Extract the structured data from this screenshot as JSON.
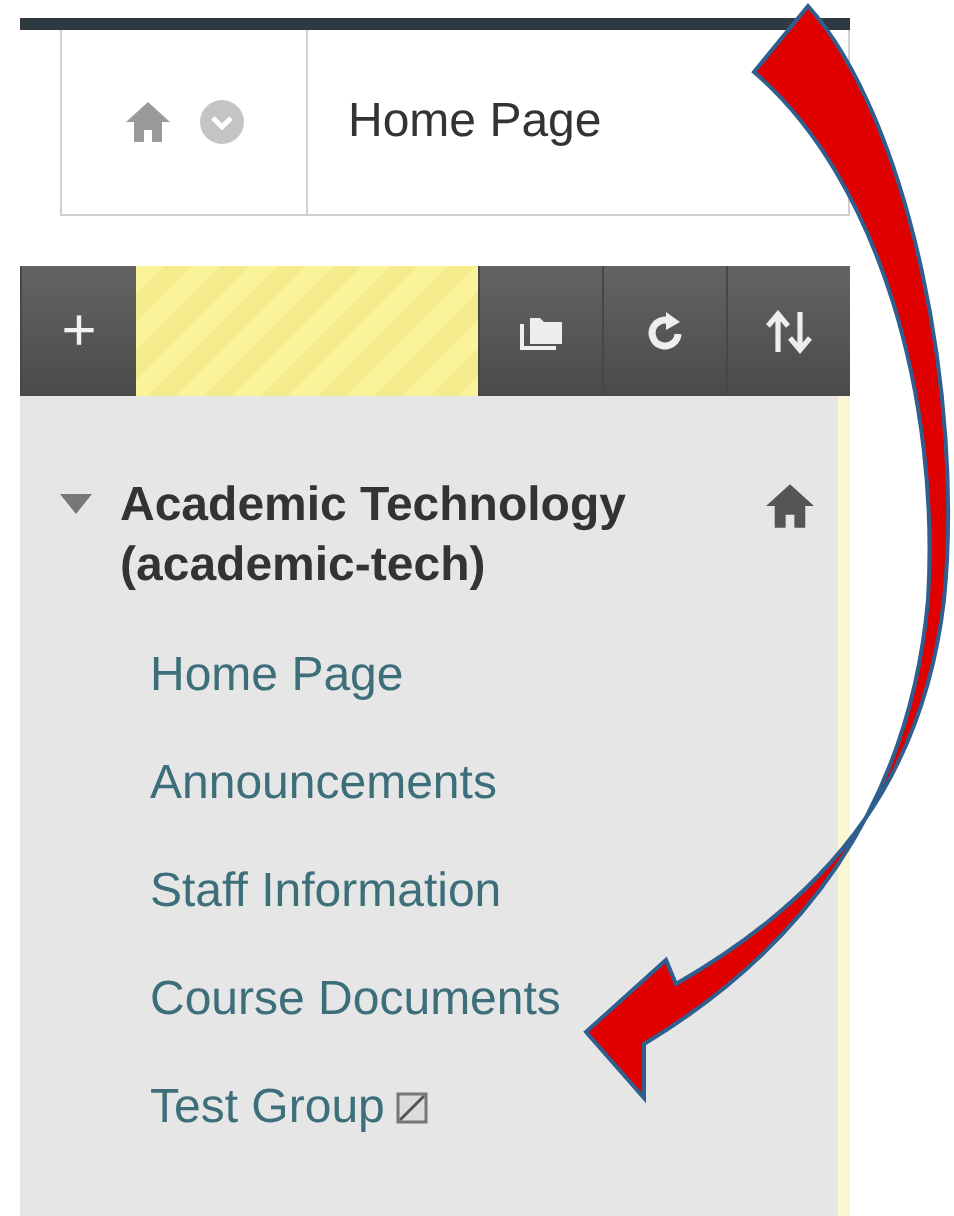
{
  "breadcrumb": {
    "title": "Home Page"
  },
  "toolbar": {
    "add_label": "+"
  },
  "course_menu": {
    "title": "Academic Technology (academic-tech)",
    "expanded": true,
    "items": [
      {
        "label": "Home Page",
        "kind": "link"
      },
      {
        "label": "Announcements",
        "kind": "link"
      },
      {
        "label": "Staff Information",
        "kind": "link"
      },
      {
        "label": "Course Documents",
        "kind": "link"
      },
      {
        "label": "Test Group",
        "kind": "hidden"
      }
    ]
  }
}
